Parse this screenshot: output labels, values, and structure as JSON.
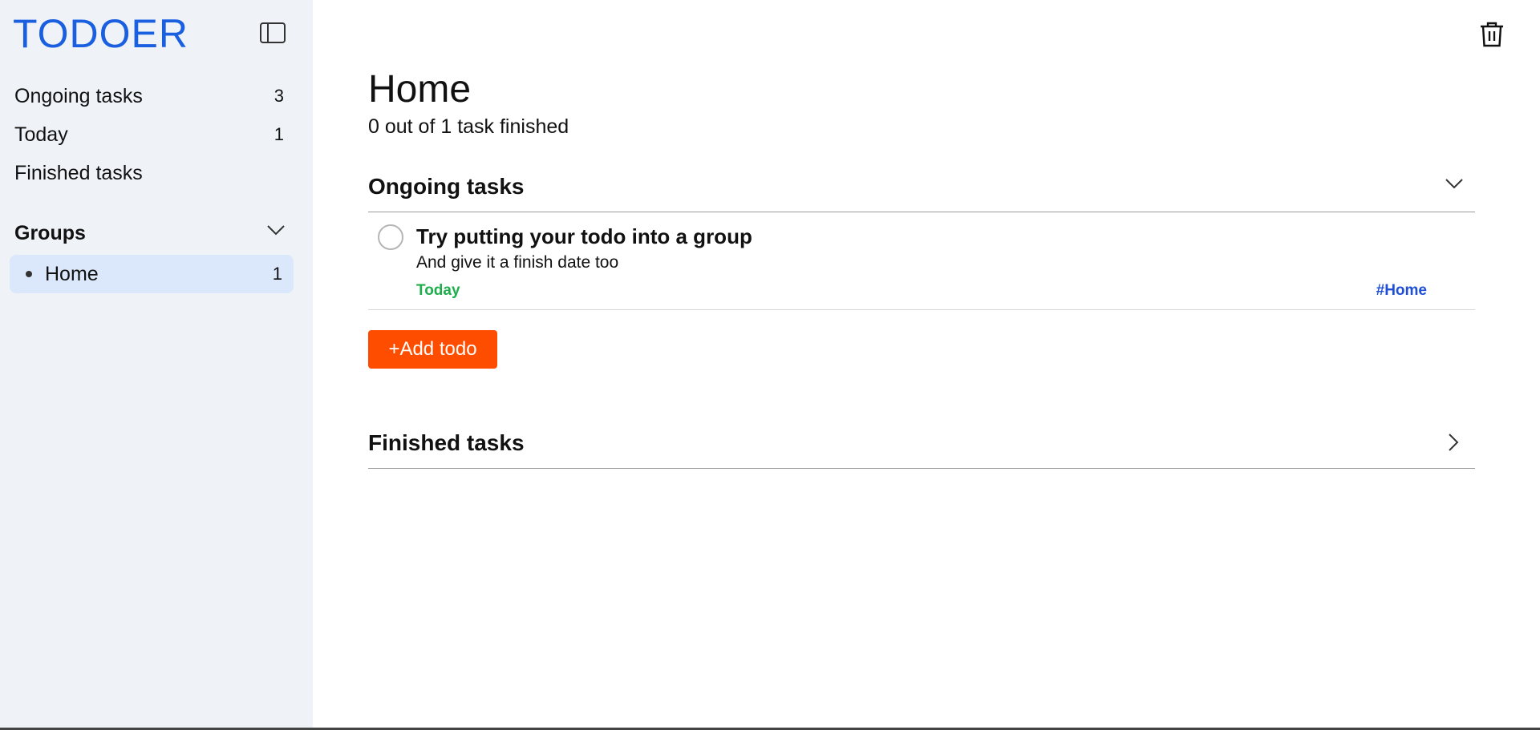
{
  "app": {
    "title": "TODOER"
  },
  "sidebar": {
    "nav": [
      {
        "label": "Ongoing tasks",
        "count": "3"
      },
      {
        "label": "Today",
        "count": "1"
      },
      {
        "label": "Finished tasks",
        "count": ""
      }
    ],
    "groups_label": "Groups",
    "groups": [
      {
        "label": "Home",
        "count": "1"
      }
    ]
  },
  "main": {
    "title": "Home",
    "progress": "0 out of 1 task finished",
    "ongoing": {
      "label": "Ongoing tasks",
      "todos": [
        {
          "title": "Try putting your todo into a group",
          "description": "And give it a finish date too",
          "date": "Today",
          "group_tag": "#Home"
        }
      ]
    },
    "add_label": "+Add todo",
    "finished": {
      "label": "Finished tasks"
    }
  },
  "colors": {
    "logo": "#1a5fe0",
    "sidebar_bg": "#eff3f8",
    "selected_group_bg": "#dbe8fb",
    "add_button": "#ff4d00",
    "date": "#1fae4c",
    "group_tag": "#1f4fd6"
  },
  "icons": {
    "sidebar_toggle": "sidebar-panel-icon",
    "trash": "trash-icon",
    "collapse": "chevron-down-icon",
    "expand": "chevron-right-icon"
  }
}
